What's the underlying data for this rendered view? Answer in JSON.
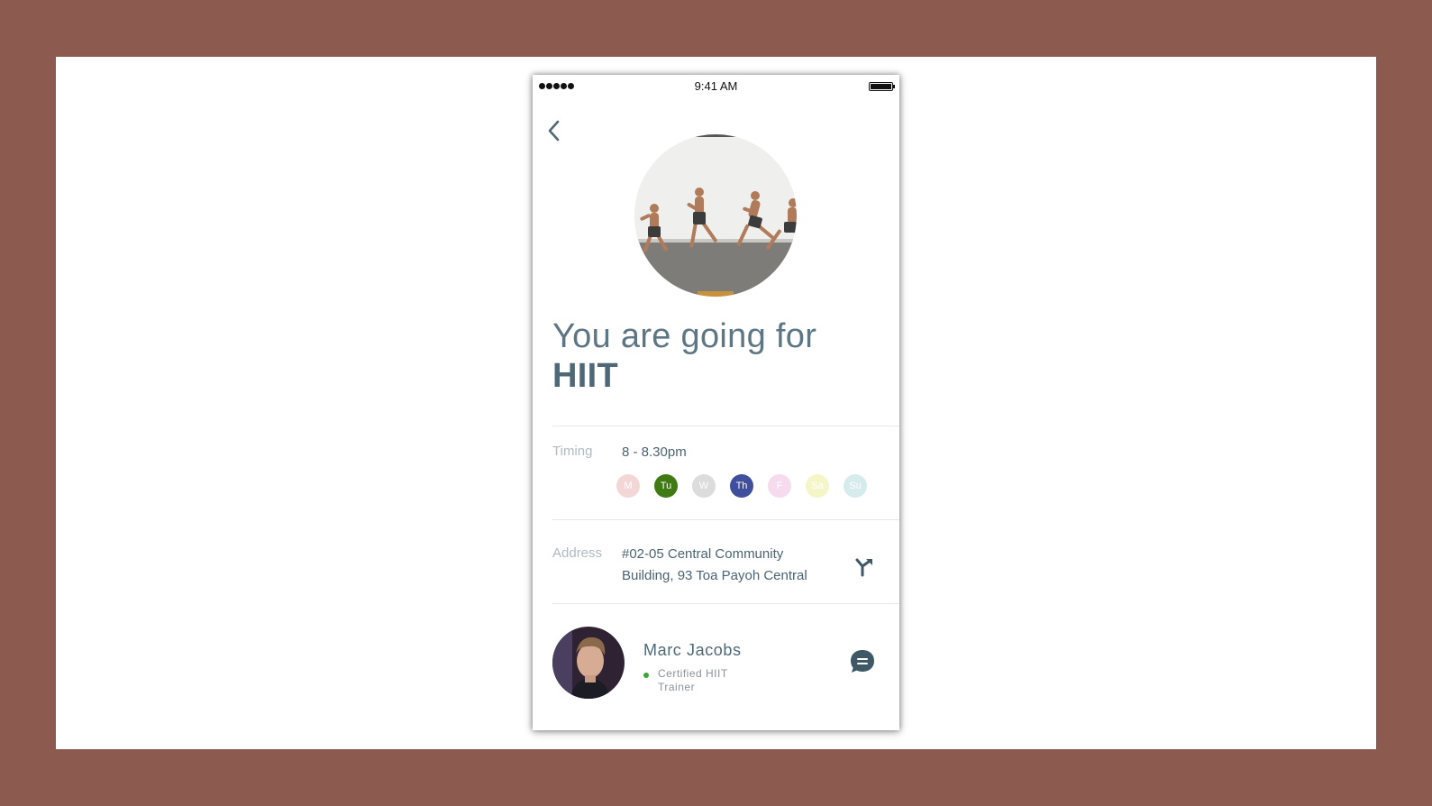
{
  "status_bar": {
    "time": "9:41 AM"
  },
  "header": {
    "back_icon": "chevron-left-icon"
  },
  "hero": {
    "image": "hiit-sprint-photo"
  },
  "title": {
    "prefix": "You are going for",
    "activity": "HIIT"
  },
  "timing": {
    "label": "Timing",
    "value": "8 - 8.30pm",
    "days": [
      {
        "label": "M",
        "color": "#f3d7d7",
        "active": false
      },
      {
        "label": "Tu",
        "color": "#3f7a12",
        "active": true
      },
      {
        "label": "W",
        "color": "#dcdcdc",
        "active": false
      },
      {
        "label": "Th",
        "color": "#3f4f9e",
        "active": true
      },
      {
        "label": "F",
        "color": "#f6dbee",
        "active": false
      },
      {
        "label": "Sa",
        "color": "#f5f6c8",
        "active": false
      },
      {
        "label": "Su",
        "color": "#d6ebeb",
        "active": false
      }
    ]
  },
  "address": {
    "label": "Address",
    "line1": "#02-05 Central Community",
    "line2": "Building, 93 Toa Payoh Central",
    "directions_icon": "directions-icon"
  },
  "trainer": {
    "name": "Marc Jacobs",
    "role": "Certified HIIT Trainer",
    "status_color": "#3aa534",
    "chat_icon": "chat-icon"
  },
  "colors": {
    "accent": "#4f6877",
    "frame": "#8c5a4e"
  }
}
